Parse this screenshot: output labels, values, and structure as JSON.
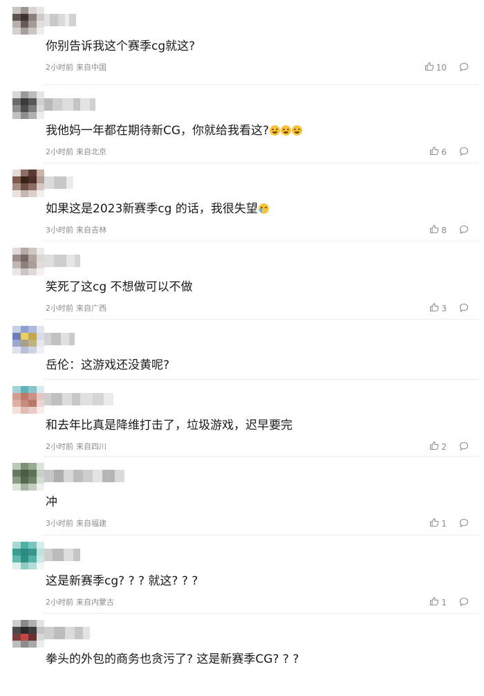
{
  "comments": [
    {
      "text": "你别告诉我这个赛季cg就这?",
      "emoji": "",
      "time": "2小时前",
      "location": "来自中国",
      "likes": "10",
      "avatar": [
        "#c9c6c4",
        "#9e9693",
        "#d8d4d2",
        "#e9e7e6",
        "#5e5350",
        "#3e3330",
        "#8a807c",
        "#d0ccca",
        "#b7b1ae",
        "#675b57",
        "#a49c98",
        "#e2dfde",
        "#d6d2d0",
        "#a8a09d",
        "#cbc6c4",
        "#f0eeed"
      ],
      "name": [
        "#e3e3e3",
        "#c9c9c9",
        "#dadada",
        "#eeeeee",
        "#d2d2d2"
      ]
    },
    {
      "text": "我他妈一年都在期待新CG，你就给我看这?",
      "emoji": "laugh3",
      "time": "2小时前",
      "location": "来自北京",
      "likes": "6",
      "avatar": [
        "#d7d7d7",
        "#9a9a9a",
        "#bcbcbc",
        "#e6e6e6",
        "#6b6b6b",
        "#3b3b3b",
        "#585858",
        "#cfcfcf",
        "#909090",
        "#4f4f4f",
        "#7c7c7c",
        "#dadada",
        "#c2c2c2",
        "#8f8f8f",
        "#b0b0b0",
        "#eeeeee"
      ],
      "name": [
        "#b9b9b9",
        "#cfcfcf",
        "#dddddd",
        "#c4c4c4",
        "#e4e4e4",
        "#d0d0d0"
      ]
    },
    {
      "text": "如果这是2023新赛季cg 的话，我很失望",
      "emoji": "cry",
      "time": "3小时前",
      "location": "来自吉林",
      "likes": "8",
      "avatar": [
        "#e4dcd8",
        "#8d6e64",
        "#5b3b31",
        "#c9b3ab",
        "#7e5a4f",
        "#3a2219",
        "#4e2f25",
        "#b89d94",
        "#a58c84",
        "#6d4f46",
        "#8d6e64",
        "#d6c8c3",
        "#eae3e0",
        "#c8b7b1",
        "#dccfca",
        "#f3efed"
      ],
      "name": [
        "#dcdcdc",
        "#c8c8c8",
        "#ebebeb"
      ]
    },
    {
      "text": "笑死了这cg 不想做可以不做",
      "emoji": "",
      "time": "2小时前",
      "location": "来自广西",
      "likes": "3",
      "avatar": [
        "#e0dada",
        "#b6a9a7",
        "#cfc6c4",
        "#ececec",
        "#9c8d8a",
        "#766763",
        "#b0a3a0",
        "#dcd6d4",
        "#c2b8b6",
        "#8e807d",
        "#a99d9a",
        "#e2dddc",
        "#eae6e5",
        "#cdc5c3",
        "#dfdad9",
        "#f4f2f1"
      ],
      "name": [
        "#dedede",
        "#cfcfcf",
        "#e6e6e6",
        "#d6d6d6"
      ]
    },
    {
      "text": "岳伦：这游戏还没黄呢?",
      "emoji": "",
      "time": "",
      "location": "",
      "likes": "",
      "avatar": [
        "#c7cfe3",
        "#8f9fd0",
        "#aeb9dd",
        "#e4e7f0",
        "#6d7fb8",
        "#e8cf6a",
        "#c5a84e",
        "#d8dce8",
        "#9aa7cf",
        "#a7a08a",
        "#c1b37d",
        "#e6e8ee",
        "#dfe2ea",
        "#b8c0db",
        "#cfd4e4",
        "#f0f1f5"
      ],
      "name": [
        "#d3d3d3",
        "#c1c1c1",
        "#e0e0e0",
        "#cacaca"
      ]
    },
    {
      "text": "和去年比真是降维打击了，垃圾游戏，迟早要完",
      "emoji": "",
      "time": "2小时前",
      "location": "来自四川",
      "likes": "2",
      "avatar": [
        "#a4d3d6",
        "#5fb3b8",
        "#88c4c8",
        "#d8ecee",
        "#d39c90",
        "#c07a6c",
        "#cc9184",
        "#e3c7c0",
        "#deb0a6",
        "#c48b7e",
        "#b6786b",
        "#edd6d1",
        "#f1e1dd",
        "#e2bcb3",
        "#e9ccc6",
        "#f7ecea"
      ],
      "name": [
        "#cfcfcf",
        "#bfbfbf",
        "#dcdcdc",
        "#c8c8c8",
        "#e1e1e1",
        "#d5d5d5",
        "#ebebeb"
      ]
    },
    {
      "text": "冲",
      "emoji": "",
      "time": "3小时前",
      "location": "来自福建",
      "likes": "1",
      "avatar": [
        "#bcc7b9",
        "#7d8f77",
        "#9aa995",
        "#dde3db",
        "#677a61",
        "#4a5e44",
        "#5e7258",
        "#c6cfc3",
        "#8b9b86",
        "#55694f",
        "#71846b",
        "#d3dad1",
        "#dfe4dd",
        "#a6b3a2",
        "#c2ccbf",
        "#eef1ed"
      ],
      "name": [
        "#c6c6c6",
        "#aeaeae",
        "#d9d9d9",
        "#bdbdbd",
        "#cecece",
        "#e3e3e3",
        "#b5b5b5",
        "#dadada"
      ]
    },
    {
      "text": "这是新赛季cg? ? ? 就这? ? ?",
      "emoji": "",
      "time": "2小时前",
      "location": "来自内蒙古",
      "likes": "1",
      "avatar": [
        "#a9d8d3",
        "#4fb0a6",
        "#7dc4bc",
        "#d6edea",
        "#3d9c92",
        "#2a8b80",
        "#39958a",
        "#bfe2de",
        "#63b8ae",
        "#2f9186",
        "#55b2a8",
        "#cbe8e4",
        "#dbefec",
        "#8fcbc3",
        "#b3dcd7",
        "#eef7f6"
      ],
      "name": [
        "#cfcfcf",
        "#bbbbbb",
        "#dddddd",
        "#c5c5c5"
      ]
    },
    {
      "text": "拳头的外包的商务也贪污了? 这是新赛季CG? ? ?",
      "emoji": "",
      "time": "",
      "location": "",
      "likes": "",
      "avatar": [
        "#cfcfcf",
        "#8a8a8a",
        "#b0b0b0",
        "#e3e3e3",
        "#4a4a4a",
        "#2a2a2a",
        "#3d3d3d",
        "#c4c4c4",
        "#7a4040",
        "#c04848",
        "#6a3030",
        "#d8d8d8",
        "#bdbdbd",
        "#8d8d8d",
        "#a8a8a8",
        "#ededed"
      ],
      "name": [
        "#cfcfcf",
        "#bdbdbd",
        "#dcdcdc",
        "#c6c6c6",
        "#e3e3e3"
      ]
    }
  ]
}
